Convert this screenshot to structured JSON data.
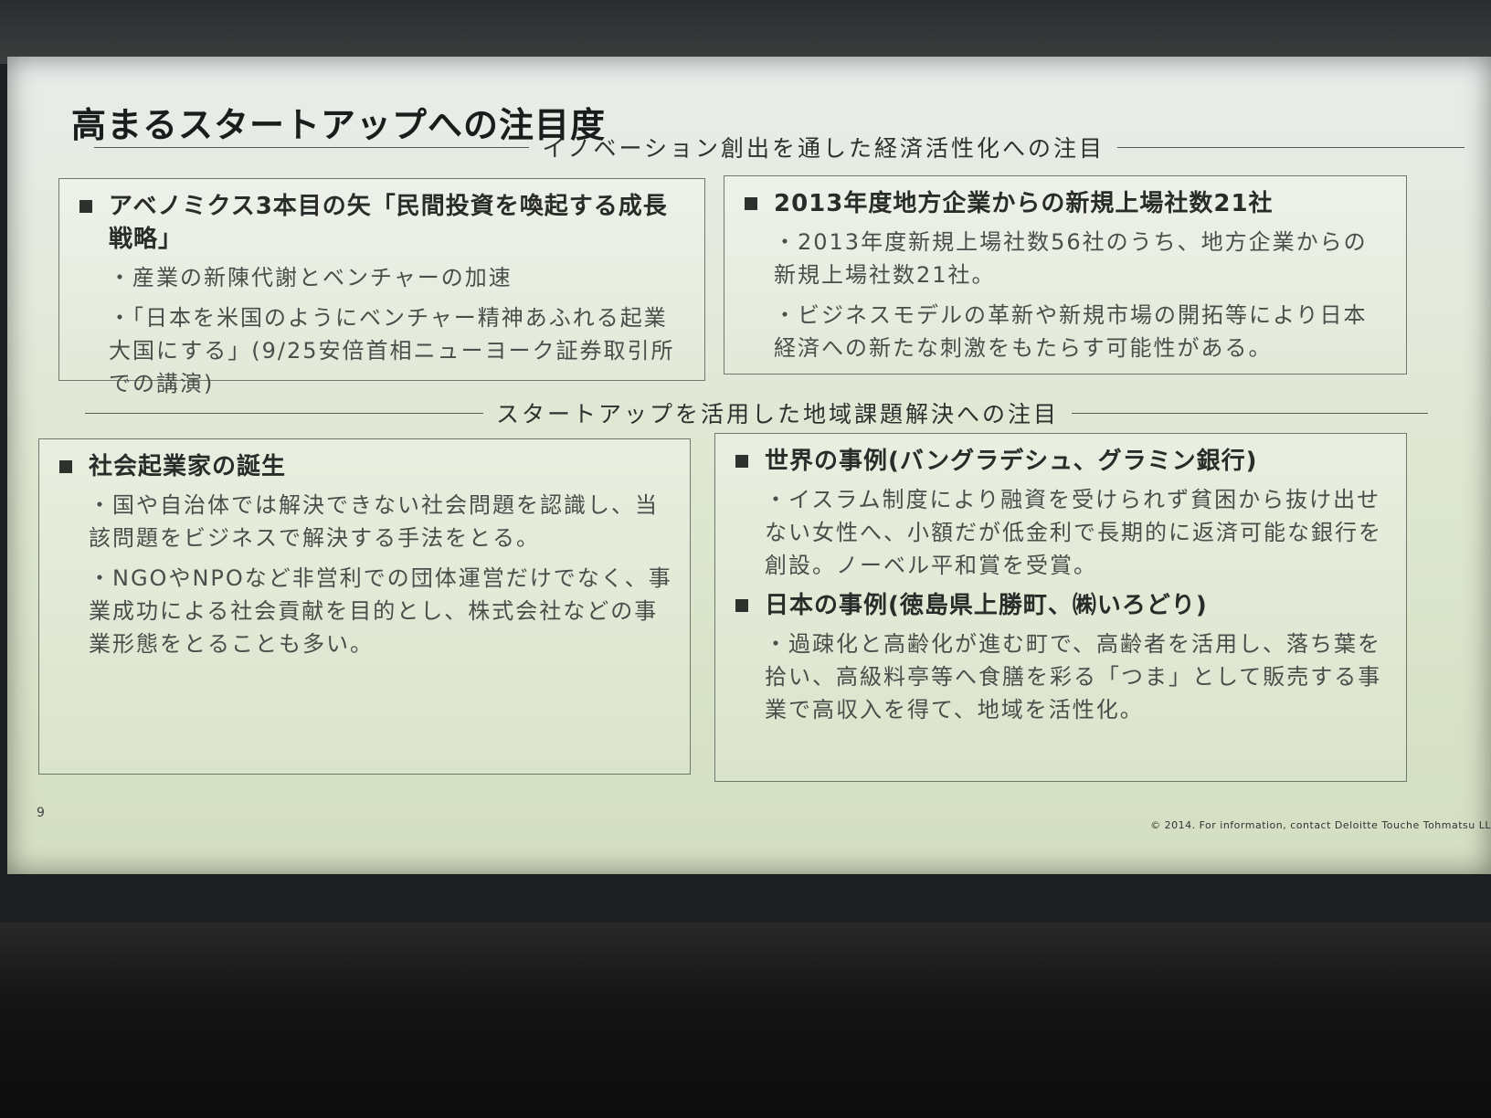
{
  "slide": {
    "title": "高まるスタートアップへの注目度",
    "page_number": "9",
    "copyright": "© 2014. For information, contact Deloitte Touche Tohmatsu LL"
  },
  "section1": {
    "header": "イノベーション創出を通した経済活性化への注目",
    "box1": {
      "heading": "アベノミクス3本目の矢「民間投資を喚起する成長戦略」",
      "body": [
        "・産業の新陳代謝とベンチャーの加速",
        "・「日本を米国のようにベンチャー精神あふれる起業大国にする」(9/25安倍首相ニューヨーク証券取引所での講演)"
      ]
    },
    "box2": {
      "heading": "2013年度地方企業からの新規上場社数21社",
      "body": [
        "・2013年度新規上場社数56社のうち、地方企業からの新規上場社数21社。",
        "・ビジネスモデルの革新や新規市場の開拓等により日本経済への新たな刺激をもたらす可能性がある。"
      ]
    }
  },
  "section2": {
    "header": "スタートアップを活用した地域課題解決への注目",
    "box3": {
      "heading": "社会起業家の誕生",
      "body": [
        "・国や自治体では解決できない社会問題を認識し、当該問題をビジネスで解決する手法をとる。",
        "・NGOやNPOなど非営利での団体運営だけでなく、事業成功による社会貢献を目的とし、株式会社などの事業形態をとることも多い。"
      ]
    },
    "box4": {
      "heading1": "世界の事例(バングラデシュ、グラミン銀行)",
      "body1": [
        "・イスラム制度により融資を受けられず貧困から抜け出せない女性へ、小額だが低金利で長期的に返済可能な銀行を創設。ノーベル平和賞を受賞。"
      ],
      "heading2": "日本の事例(徳島県上勝町、㈱いろどり)",
      "body2": [
        "・過疎化と高齢化が進む町で、高齢者を活用し、落ち葉を拾い、高級料亭等へ食膳を彩る「つま」として販売する事業で高収入を得て、地域を活性化。"
      ]
    }
  }
}
